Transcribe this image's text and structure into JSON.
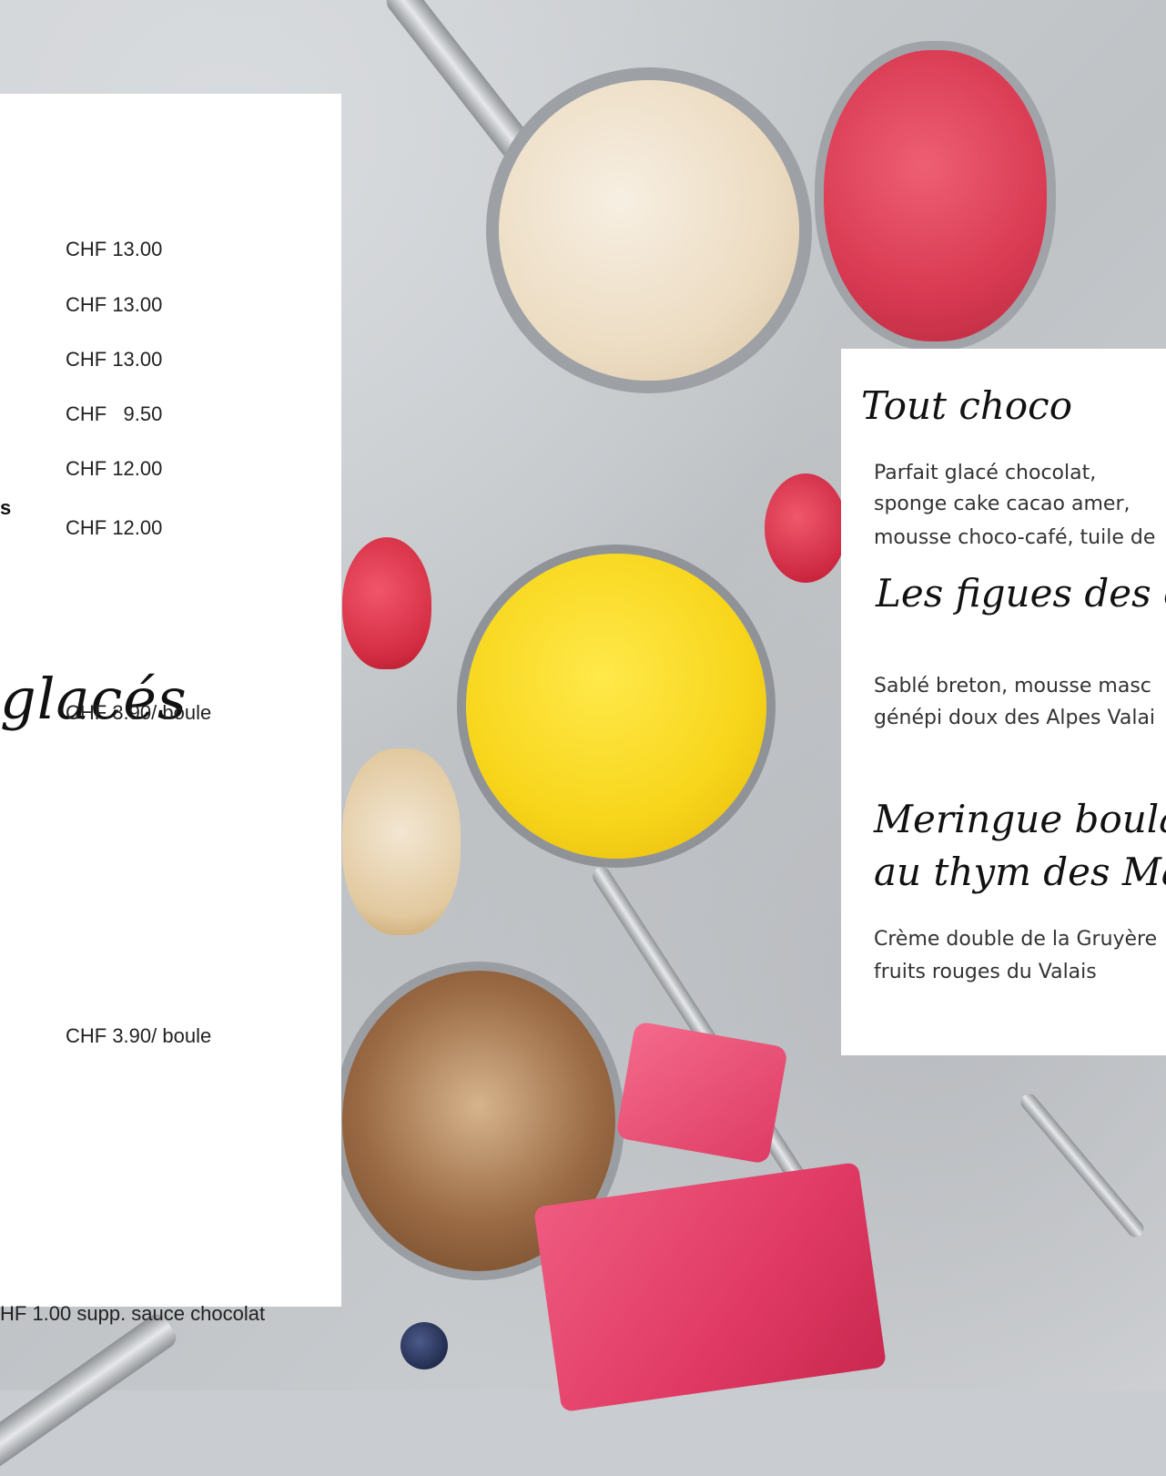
{
  "left_menu": {
    "prices": [
      "CHF 13.00",
      "CHF 13.00",
      "CHF 13.00",
      "CHF   9.50",
      "CHF 12.00",
      "CHF 12.00"
    ],
    "fragment_bold": "s",
    "section_title_fragment": "glacés",
    "scoop_price_1": "CHF 3.90/ boule",
    "scoop_price_2": "CHF 3.90/ boule",
    "supplement": "HF 1.00 supp. sauce chocolat"
  },
  "right_menu": {
    "items": [
      {
        "title": "Tout choco",
        "desc": [
          "Parfait glacé chocolat,",
          "sponge cake cacao amer,",
          "mousse choco-café, tuile de"
        ]
      },
      {
        "title": "Les figues des ch",
        "desc": [
          "Sablé breton, mousse masc",
          "génépi doux des Alpes Valai"
        ]
      },
      {
        "title": "Meringue boulang",
        "title_line2": "au thym des Mar",
        "desc": [
          "Crème double de la Gruyère",
          "fruits rouges du Valais"
        ]
      }
    ]
  },
  "colors": {
    "card_background": "#ffffff",
    "text": "#222222",
    "background_photo": "#c9ccd0"
  }
}
